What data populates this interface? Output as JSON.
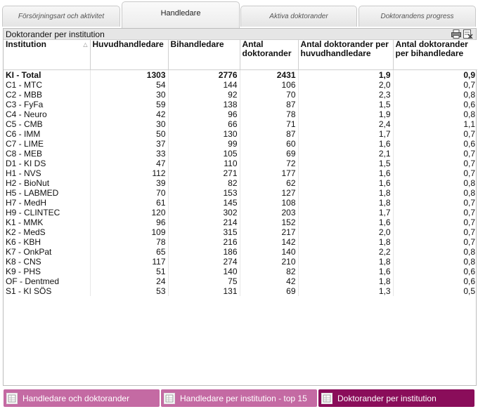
{
  "tabs": [
    {
      "label": "Försörjningsart och aktivitet",
      "active": false
    },
    {
      "label": "Handledare",
      "active": true
    },
    {
      "label": "Aktiva doktorander",
      "active": false
    },
    {
      "label": "Doktorandens progress",
      "active": false
    }
  ],
  "panel": {
    "title": "Doktorander per institution",
    "icons": [
      "printer-icon",
      "export-excel-icon"
    ]
  },
  "table": {
    "columns": [
      "Institution",
      "Huvudhandledare",
      "Bihandledare",
      "Antal doktorander",
      "Antal doktorander per huvudhandledare",
      "Antal doktorander per bihandledare"
    ],
    "total": [
      "KI - Total",
      "1303",
      "2776",
      "2431",
      "1,9",
      "0,9"
    ],
    "rows": [
      [
        "C1 - MTC",
        "54",
        "144",
        "106",
        "2,0",
        "0,7"
      ],
      [
        "C2 - MBB",
        "30",
        "92",
        "70",
        "2,3",
        "0,8"
      ],
      [
        "C3 - FyFa",
        "59",
        "138",
        "87",
        "1,5",
        "0,6"
      ],
      [
        "C4 - Neuro",
        "42",
        "96",
        "78",
        "1,9",
        "0,8"
      ],
      [
        "C5 - CMB",
        "30",
        "66",
        "71",
        "2,4",
        "1,1"
      ],
      [
        "C6 - IMM",
        "50",
        "130",
        "87",
        "1,7",
        "0,7"
      ],
      [
        "C7 - LIME",
        "37",
        "99",
        "60",
        "1,6",
        "0,6"
      ],
      [
        "C8 - MEB",
        "33",
        "105",
        "69",
        "2,1",
        "0,7"
      ],
      [
        "D1 - KI DS",
        "47",
        "110",
        "72",
        "1,5",
        "0,7"
      ],
      [
        "H1 - NVS",
        "112",
        "271",
        "177",
        "1,6",
        "0,7"
      ],
      [
        "H2 - BioNut",
        "39",
        "82",
        "62",
        "1,6",
        "0,8"
      ],
      [
        "H5 - LABMED",
        "70",
        "153",
        "127",
        "1,8",
        "0,8"
      ],
      [
        "H7 - MedH",
        "61",
        "145",
        "108",
        "1,8",
        "0,7"
      ],
      [
        "H9 - CLINTEC",
        "120",
        "302",
        "203",
        "1,7",
        "0,7"
      ],
      [
        "K1 - MMK",
        "96",
        "214",
        "152",
        "1,6",
        "0,7"
      ],
      [
        "K2 - MedS",
        "109",
        "315",
        "217",
        "2,0",
        "0,7"
      ],
      [
        "K6 - KBH",
        "78",
        "216",
        "142",
        "1,8",
        "0,7"
      ],
      [
        "K7 - OnkPat",
        "65",
        "186",
        "140",
        "2,2",
        "0,8"
      ],
      [
        "K8 - CNS",
        "117",
        "274",
        "210",
        "1,8",
        "0,8"
      ],
      [
        "K9 - PHS",
        "51",
        "140",
        "82",
        "1,6",
        "0,6"
      ],
      [
        "OF - Dentmed",
        "24",
        "75",
        "42",
        "1,8",
        "0,6"
      ],
      [
        "S1 - KI SÖS",
        "53",
        "131",
        "69",
        "1,3",
        "0,5"
      ]
    ]
  },
  "bottom_tabs": [
    {
      "label": "Handledare och doktorander",
      "active": false
    },
    {
      "label": "Handledare per institution - top 15",
      "active": false
    },
    {
      "label": "Doktorander per institution",
      "active": true
    }
  ],
  "colors": {
    "bottom_tab": "#c46aa3",
    "bottom_tab_active": "#8a0d5a"
  }
}
